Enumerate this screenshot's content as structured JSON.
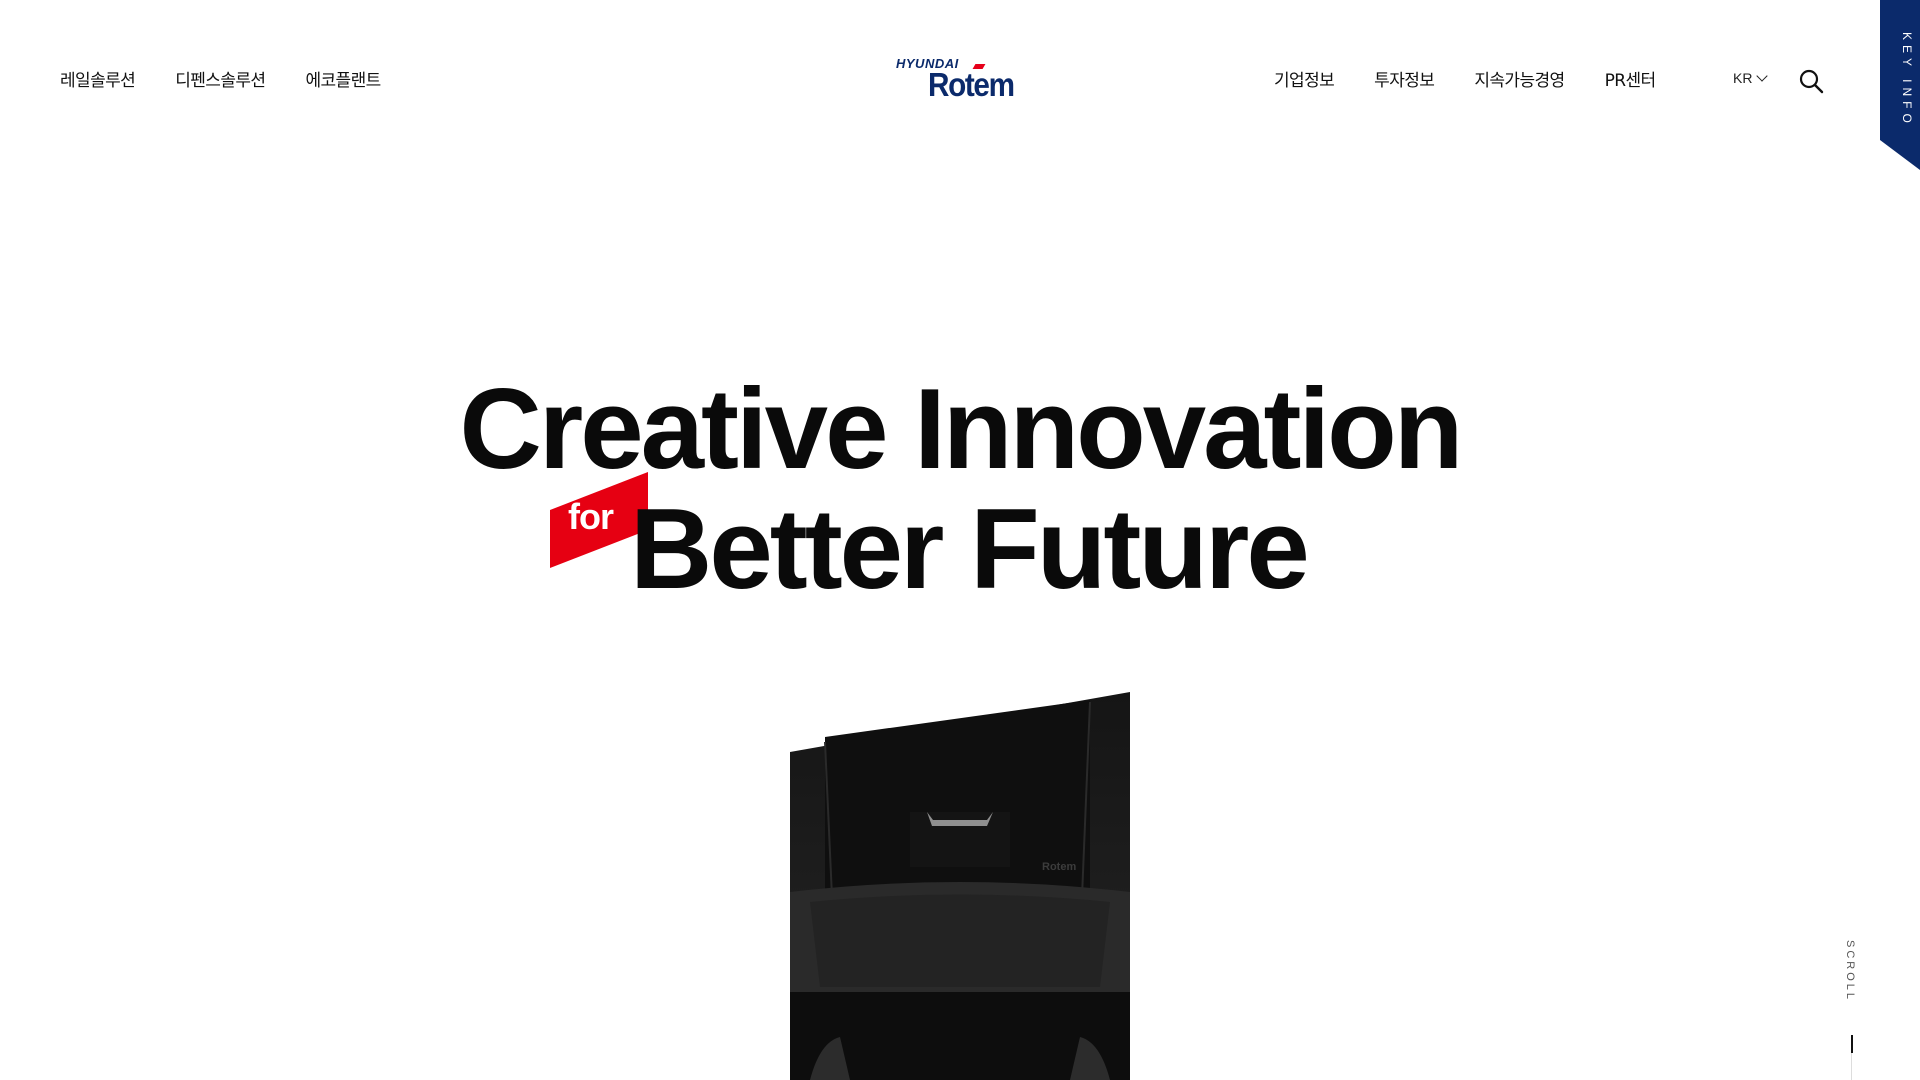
{
  "nav": {
    "left": [
      "레일솔루션",
      "디펜스솔루션",
      "에코플랜트"
    ],
    "right": [
      "기업정보",
      "투자정보",
      "지속가능경영",
      "PR센터"
    ]
  },
  "logo": {
    "top": "HYUNDAI",
    "main": "Rotem"
  },
  "language": "KR",
  "key_info": "KEY INFO",
  "hero": {
    "line1": "Creative Innovation",
    "for": "for",
    "line2": "Better Future"
  },
  "scroll_label": "SCROLL",
  "colors": {
    "brand_navy": "#0b2a6b",
    "accent_red": "#e60012",
    "text": "#0a0a0a"
  },
  "icons": {
    "search": "search-icon",
    "chevron": "chevron-down-icon"
  }
}
